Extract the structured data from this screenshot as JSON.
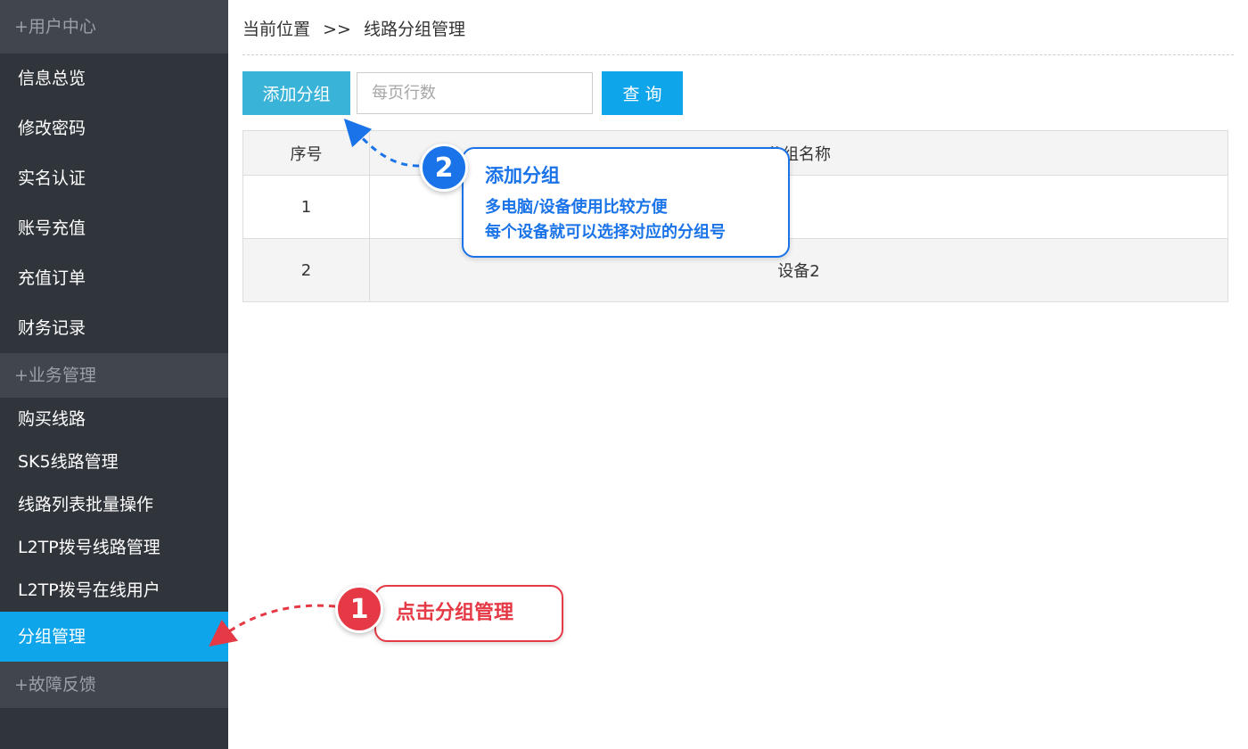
{
  "sidebar": {
    "groups": {
      "user_center": "+用户中心",
      "business": "+业务管理",
      "fault": "+故障反馈"
    },
    "items": [
      {
        "label": "信息总览"
      },
      {
        "label": "修改密码"
      },
      {
        "label": "实名认证"
      },
      {
        "label": "账号充值"
      },
      {
        "label": "充值订单"
      },
      {
        "label": "财务记录"
      },
      {
        "label": "购买线路"
      },
      {
        "label": "SK5线路管理"
      },
      {
        "label": "线路列表批量操作"
      },
      {
        "label": "L2TP拨号线路管理"
      },
      {
        "label": "L2TP拨号在线用户"
      },
      {
        "label": "分组管理"
      }
    ],
    "active_item": "分组管理",
    "active_color": "#0fa5ea"
  },
  "breadcrumb": {
    "prefix": "当前位置",
    "separator": ">>",
    "current": "线路分组管理"
  },
  "toolbar": {
    "add_label": "添加分组",
    "rows_placeholder": "每页行数",
    "query_label": "查询"
  },
  "table": {
    "headers": [
      "序号",
      "分组名称"
    ],
    "rows": [
      {
        "index": "1",
        "name": ""
      },
      {
        "index": "2",
        "name": "设备2"
      }
    ]
  },
  "annotations": {
    "step2": {
      "number": "2",
      "title": "添加分组",
      "lines": [
        "多电脑/设备使用比较方便",
        "每个设备就可以选择对应的分组号"
      ],
      "color": "#1a73e8"
    },
    "step1": {
      "number": "1",
      "text": "点击分组管理",
      "color": "#e53945"
    }
  }
}
